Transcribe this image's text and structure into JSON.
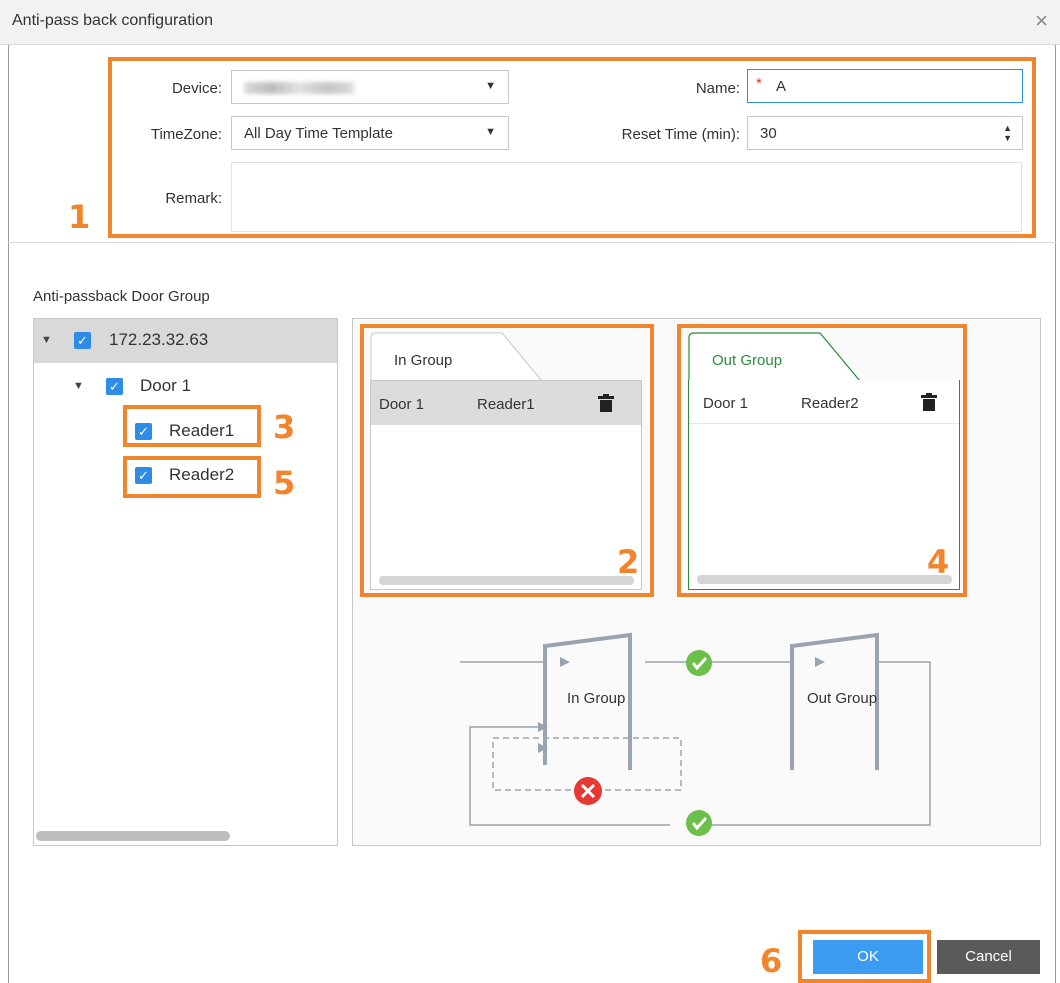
{
  "window": {
    "title": "Anti-pass back configuration",
    "close_glyph": "×"
  },
  "form": {
    "device_label": "Device:",
    "device_value": "",
    "timezone_label": "TimeZone:",
    "timezone_value": "All Day Time Template",
    "remark_label": "Remark:",
    "remark_value": "",
    "name_label": "Name:",
    "name_required_mark": "*",
    "name_value": "A",
    "reset_label": "Reset Time (min):",
    "reset_value": "30"
  },
  "door_group": {
    "title": "Anti-passback Door Group",
    "tree": {
      "device": "172.23.32.63",
      "door": "Door 1",
      "readers": [
        "Reader1",
        "Reader2"
      ]
    }
  },
  "in_group": {
    "tab": "In Group",
    "rows": [
      {
        "door": "Door 1",
        "reader": "Reader1"
      }
    ]
  },
  "out_group": {
    "tab": "Out Group",
    "rows": [
      {
        "door": "Door 1",
        "reader": "Reader2"
      }
    ]
  },
  "diagram": {
    "in_label": "In Group",
    "out_label": "Out Group"
  },
  "annotations": [
    "1",
    "2",
    "3",
    "4",
    "5",
    "6"
  ],
  "buttons": {
    "ok": "OK",
    "cancel": "Cancel"
  },
  "colors": {
    "annotation": "#f0852d",
    "primary": "#3b9cf2",
    "accent_green": "#2e8b3e",
    "error_red": "#e53935",
    "success_green": "#6cc04a"
  }
}
